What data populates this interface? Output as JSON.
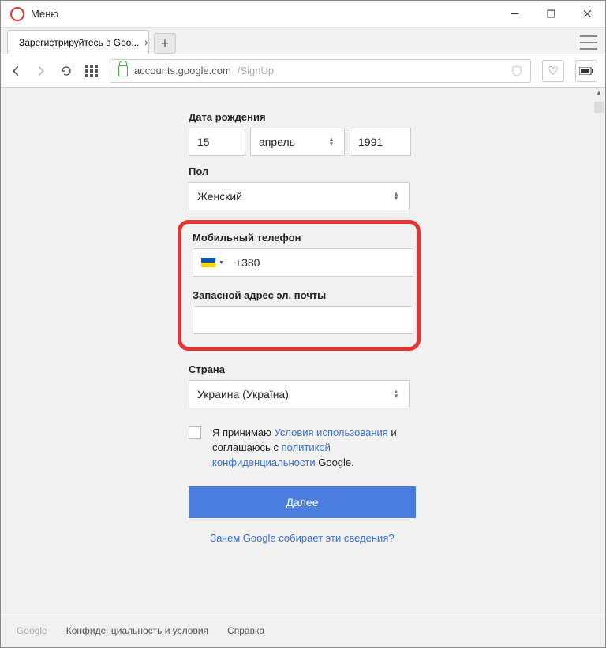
{
  "window": {
    "menu": "Меню"
  },
  "tab": {
    "title": "Зарегистрируйтесь в Goo..."
  },
  "url": {
    "host": "accounts.google.com",
    "path": "/SignUp"
  },
  "form": {
    "dob_label": "Дата рождения",
    "day": "15",
    "month": "апрель",
    "year": "1991",
    "gender_label": "Пол",
    "gender_value": "Женский",
    "phone_label": "Мобильный телефон",
    "phone_prefix": "+380",
    "email_label": "Запасной адрес эл. почты",
    "email_value": "",
    "country_label": "Страна",
    "country_value": "Украина (Україна)"
  },
  "consent": {
    "prefix": "Я принимаю ",
    "terms": "Условия использования",
    "mid": " и соглашаюсь с ",
    "privacy": "политикой конфиденциальности",
    "suffix": " Google."
  },
  "next": "Далее",
  "why": {
    "text": "Зачем Google собирает эти сведения?"
  },
  "footer": {
    "brand": "Google",
    "privterms": "Конфиденциальность и условия",
    "help": "Справка"
  }
}
